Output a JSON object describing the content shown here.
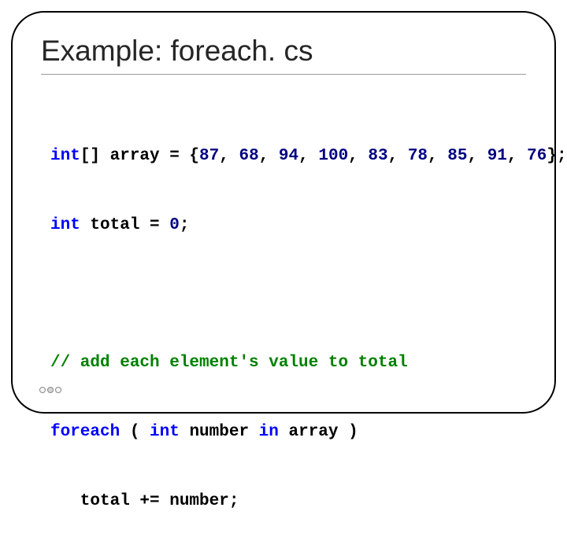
{
  "title": "Example: foreach. cs",
  "code": {
    "l1": {
      "kw_int_arr": "int",
      "rest1": "[] array = {",
      "n1": "87",
      "c1": ", ",
      "n2": "68",
      "c2": ", ",
      "n3": "94",
      "c3": ", ",
      "n4": "100",
      "c4": ", ",
      "n5": "83",
      "c5": ", ",
      "n6": "78",
      "c6": ", ",
      "n7": "85",
      "c7": ", ",
      "n8": "91",
      "c8": ", ",
      "n9": "76",
      "rest2": "};"
    },
    "l2": {
      "kw_int": "int",
      "rest": " total = ",
      "zero": "0",
      "semi": ";"
    },
    "l3_comment": "// add each element's value to total",
    "l4": {
      "kw_foreach": "foreach",
      "open": " ( ",
      "kw_int": "int",
      "mid": " number ",
      "kw_in": "in",
      "close": " array )"
    },
    "l5": "   total += number;"
  }
}
